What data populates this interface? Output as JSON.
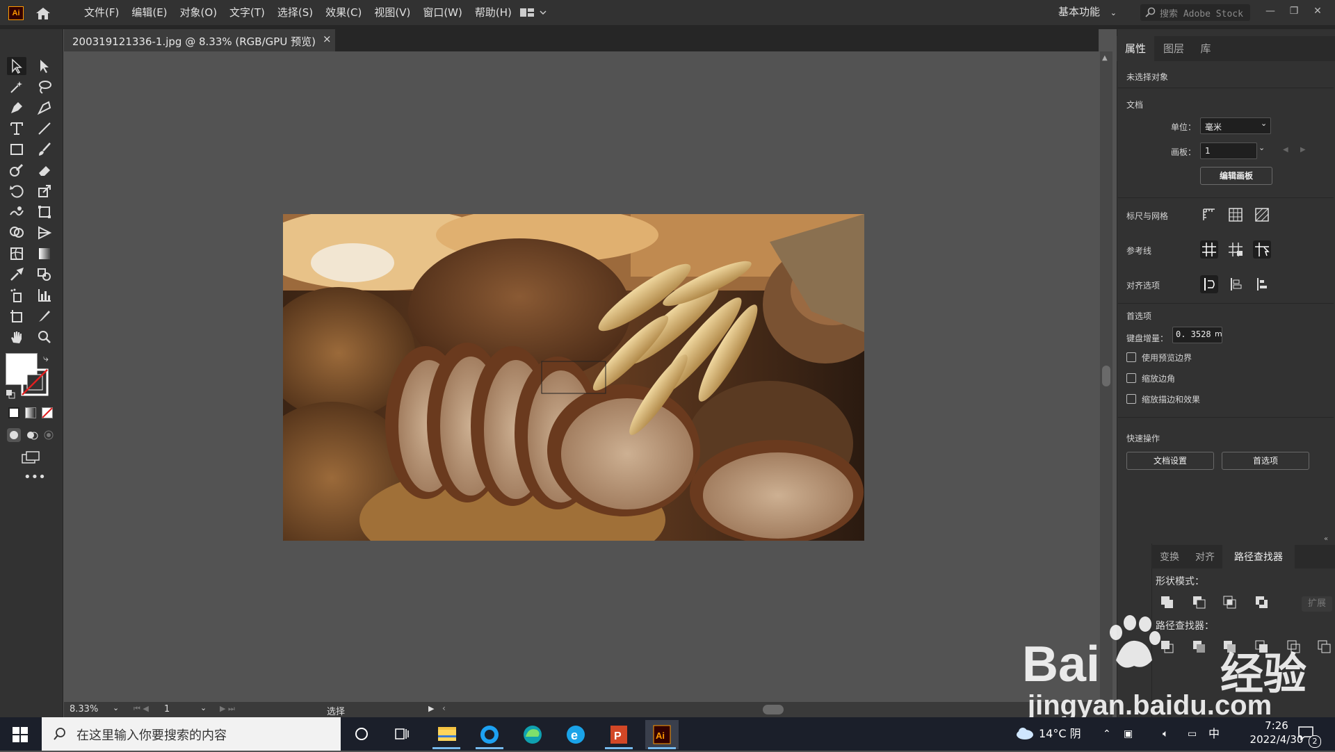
{
  "app": {
    "logo": "Ai",
    "menu": [
      "文件(F)",
      "编辑(E)",
      "对象(O)",
      "文字(T)",
      "选择(S)",
      "效果(C)",
      "视图(V)",
      "窗口(W)",
      "帮助(H)"
    ],
    "workspace": "基本功能",
    "search_placeholder": "搜索 Adobe Stock"
  },
  "document": {
    "tab_title": "200319121336-1.jpg @ 8.33% (RGB/GPU 预览)",
    "close": "×"
  },
  "statusbar": {
    "zoom": "8.33%",
    "artboard": "1",
    "tool_status": "选择"
  },
  "properties_panel": {
    "tabs": [
      "属性",
      "图层",
      "库"
    ],
    "no_selection": "未选择对象",
    "document_section": "文档",
    "unit_label": "单位：",
    "unit_value": "毫米",
    "artboard_label": "画板：",
    "artboard_value": "1",
    "edit_artboard_button": "编辑画板",
    "rulers_grid": "标尺与网格",
    "guides": "参考线",
    "align_options": "对齐选项",
    "preferences": "首选项",
    "keyboard_increment_label": "键盘增量：",
    "keyboard_increment_value": "0. 3528",
    "keyboard_increment_unit": "m",
    "checkboxes": [
      "使用预览边界",
      "缩放边角",
      "缩放描边和效果"
    ],
    "quick_actions": "快速操作",
    "doc_setup_button": "文档设置",
    "prefs_button": "首选项"
  },
  "pathfinder_panel": {
    "tabs": [
      "变换",
      "对齐",
      "路径查找器"
    ],
    "shape_modes": "形状模式：",
    "expand": "扩展",
    "pathfinders": "路径查找器："
  },
  "taskbar": {
    "search_placeholder": "在这里输入你要搜索的内容",
    "weather": "14°C 阴",
    "ime": "中",
    "time": "7:26",
    "date": "2022/4/30",
    "notifications": "2"
  },
  "watermark": {
    "brand": "Bai",
    "brand2": "经验",
    "url": "jingyan.baidu.com"
  },
  "colors": {
    "accent_ai": "#ff9a00",
    "ui_dark": "#323232",
    "canvas": "#535353",
    "taskbar": "#1b1f2a"
  }
}
